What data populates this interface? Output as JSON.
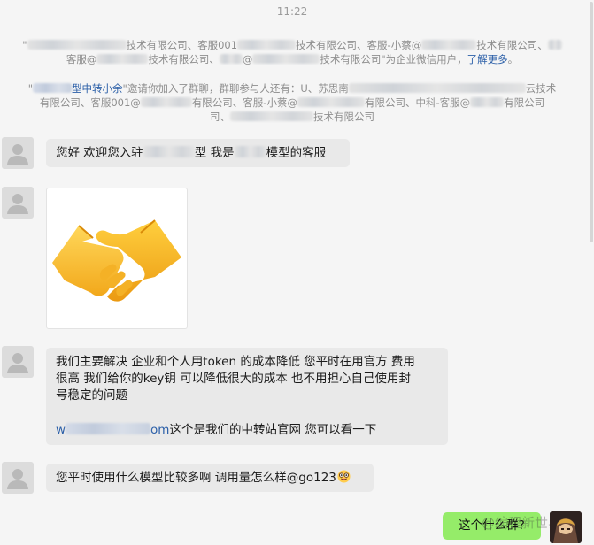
{
  "timestamp": "11:22",
  "system_notice_1": {
    "seg_a": "\"",
    "seg_b": "技术有限公司、客服001",
    "seg_c": "技术有限公司、客服-小蔡@",
    "seg_d": "技术有限公司、",
    "seg_e": "客服@",
    "seg_f": "技术有限公司、",
    "seg_g": "@",
    "seg_h": "技术有限公司\"为企业微信用户，",
    "link": "了解更多",
    "seg_i": "。"
  },
  "system_notice_2": {
    "seg_a": "\"",
    "inviter": "型中转小余",
    "seg_b": "\"邀请你加入了群聊，群聊参与人还有：U、苏思南",
    "seg_c": "云技术",
    "seg_d": "有限公司、客服001@",
    "seg_e": "有限公司、客服-小蔡@",
    "seg_f": "有限公司、中科-客服@",
    "seg_g": "有限公司",
    "seg_h": "司、",
    "seg_i": "技术有限公司"
  },
  "messages": {
    "greeting": {
      "a": "您好  欢迎您入驻",
      "b": "型 我是",
      "c": "模型的客服"
    },
    "intro": {
      "line1": "我们主要解决  企业和个人用token 的成本降低   您平时在用官方 费用",
      "line2": "很高   我们给你的key钥 可以降低很大的成本    也不用担心自己使用封",
      "line3": "号稳定的问题",
      "url_prefix": "w",
      "url_suffix": "om",
      "line4": "这个是我们的中转站官网 您可以看一下"
    },
    "question": {
      "text": "您平时使用什么模型比较多啊 调用量怎么样@go123",
      "emoji_icon": "nerd-face-icon"
    },
    "my_reply": "这个什么群?"
  },
  "sticker": {
    "icon": "handshake-icon"
  },
  "watermark": "@编程新世界",
  "colors": {
    "my_bubble": "#95ec69",
    "other_bubble": "#e9e9e9",
    "link": "#2b5fa8"
  }
}
